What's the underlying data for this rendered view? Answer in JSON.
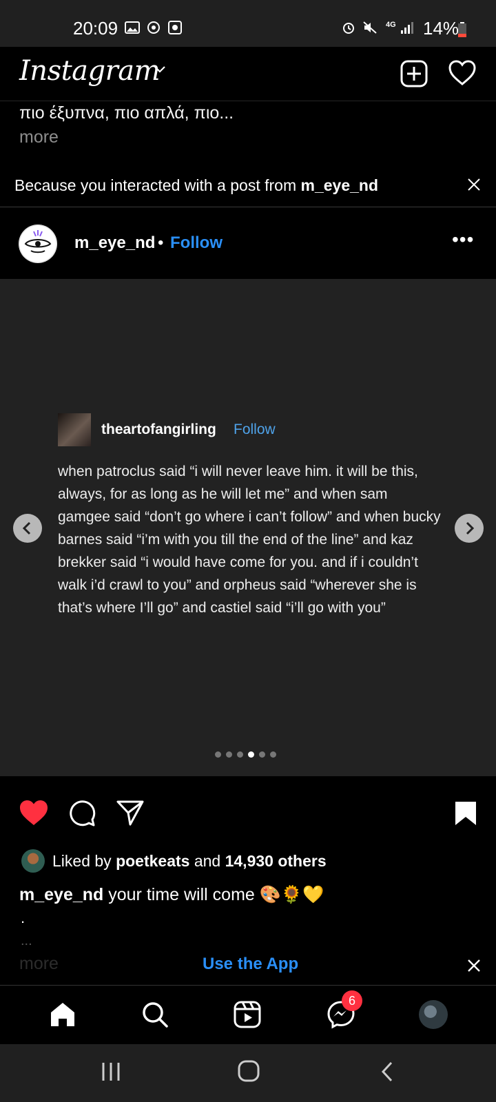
{
  "status_bar": {
    "time": "20:09",
    "network": "4G",
    "battery": "14%",
    "icons": [
      "gallery-icon",
      "cast-icon",
      "media-icon",
      "alarm-icon",
      "mute-icon",
      "network-4g-icon",
      "signal-icon",
      "battery-icon"
    ]
  },
  "header": {
    "logo": "Instagram",
    "icons": [
      "chevron-down-icon",
      "new-post-icon",
      "heart-outline-icon"
    ]
  },
  "previous_post": {
    "caption_tail": "πιο έξυπνα, πιο απλά, πιο...",
    "more_label": "more"
  },
  "suggestion": {
    "text": "Because you interacted with a post from ",
    "user": "m_eye_nd"
  },
  "post": {
    "username": "m_eye_nd",
    "separator": "•",
    "follow_label": "Follow",
    "more_menu": "•••",
    "image": {
      "author": "theartofangirling",
      "follow_label": "Follow",
      "body": "when patroclus said “i will never leave him. it will be this, always, for as long as he will let me” and when sam gamgee said “don’t go where i can’t follow” and when bucky barnes said “i’m with you till the end of the line” and kaz brekker said “i would have come for you. and if i couldn’t walk i’d crawl to you” and orpheus said “wherever she is that’s where I’ll go” and castiel said “i’ll go with you”"
    },
    "carousel": {
      "total": 6,
      "current": 4
    },
    "liked": true,
    "saved": true,
    "likes": {
      "prefix": "Liked by ",
      "user": "poetkeats",
      "middle": " and ",
      "count": "14,930 others"
    },
    "caption": {
      "user": "m_eye_nd",
      "text": " your time will come 🎨🌻💛",
      "line2": ".",
      "line3": "...",
      "more_label": "more"
    }
  },
  "banner": {
    "use_app_label": "Use the App",
    "close": "×"
  },
  "bottom_nav": {
    "items": [
      "home-icon",
      "search-icon",
      "reels-icon",
      "messenger-icon",
      "profile-avatar"
    ],
    "messenger_badge": "6"
  },
  "colors": {
    "accent": "#2a8ff7",
    "like": "#ff3040",
    "background": "#000000",
    "image_background": "#222222"
  }
}
